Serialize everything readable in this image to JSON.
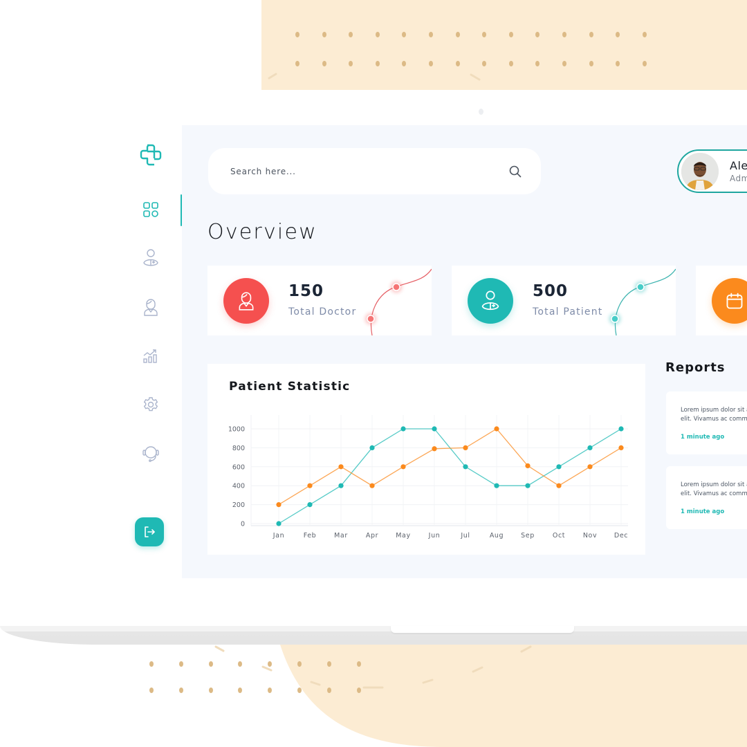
{
  "search": {
    "placeholder": "Search here..."
  },
  "profile": {
    "name": "Alex",
    "role": "Admin"
  },
  "overview": {
    "title": "Overview"
  },
  "sidebar": {
    "items": [
      {
        "name": "dashboard",
        "icon": "grid-icon",
        "active": true
      },
      {
        "name": "patients",
        "icon": "patient-icon",
        "active": false
      },
      {
        "name": "doctors",
        "icon": "doctor-icon",
        "active": false
      },
      {
        "name": "statistics",
        "icon": "chart-icon",
        "active": false
      },
      {
        "name": "settings",
        "icon": "gear-icon",
        "active": false
      },
      {
        "name": "support",
        "icon": "headset-icon",
        "active": false
      }
    ],
    "logout_icon": "logout-icon"
  },
  "stats": [
    {
      "value": "150",
      "label": "Total Doctor",
      "color": "#f5504f",
      "icon": "doctor-icon"
    },
    {
      "value": "500",
      "label": "Total Patient",
      "color": "#1fb9b4",
      "icon": "patient-icon"
    },
    {
      "value": "",
      "label": "",
      "color": "#fb8a1d",
      "icon": "calendar-icon"
    }
  ],
  "colors": {
    "accent": "#1fb9b4",
    "orange": "#fb8a1d",
    "red": "#f5504f"
  },
  "chart_data": {
    "type": "line",
    "title": "Patient Statistic",
    "categories": [
      "Jan",
      "Feb",
      "Mar",
      "Apr",
      "May",
      "Jun",
      "Jul",
      "Aug",
      "Sep",
      "Oct",
      "Nov",
      "Dec"
    ],
    "series": [
      {
        "name": "teal",
        "color": "#1fb9b4",
        "values": [
          0,
          200,
          400,
          800,
          1000,
          1000,
          600,
          400,
          400,
          600,
          800,
          1000
        ]
      },
      {
        "name": "orange",
        "color": "#fb8a1d",
        "values": [
          200,
          400,
          600,
          400,
          600,
          790,
          800,
          1000,
          610,
          400,
          600,
          800
        ]
      }
    ],
    "yticks": [
      "0",
      "200",
      "400",
      "600",
      "800",
      "1000"
    ],
    "ylim": [
      0,
      1000
    ],
    "xlabel": "",
    "ylabel": "",
    "grid": true
  },
  "reports": {
    "title": "Reports",
    "items": [
      {
        "text_line1": "Lorem ipsum dolor sit amet, consectetur",
        "text_line2": "elit. Vivamus ac commodo",
        "time": "1 minute ago"
      },
      {
        "text_line1": "Lorem ipsum dolor sit amet, consectetur",
        "text_line2": "elit. Vivamus ac commodo",
        "time": "1 minute ago"
      }
    ]
  }
}
